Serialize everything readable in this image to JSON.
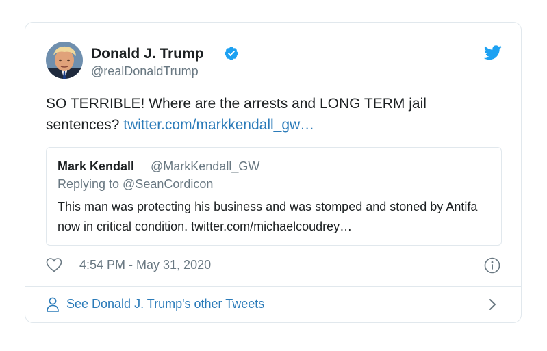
{
  "tweet": {
    "author_name": "Donald J. Trump",
    "author_handle": "@realDonaldTrump",
    "text": "SO TERRIBLE! Where are the arrests and LONG TERM jail sentences? ",
    "link_text": "twitter.com/markkendall_gw…",
    "timestamp": "4:54 PM - May 31, 2020",
    "icons": [
      "verified-badge-icon",
      "twitter-bird-icon",
      "heart-icon",
      "info-icon",
      "person-icon",
      "chevron-right-icon"
    ]
  },
  "quote": {
    "author_name": "Mark Kendall",
    "author_handle": "@MarkKendall_GW",
    "replying_to": "Replying to @SeanCordicon",
    "text": "This man was protecting his business and was stomped and stoned by Antifa now in critical condition. twitter.com/michaelcoudrey…"
  },
  "footer": {
    "see_more_label": "See Donald J. Trump's other Tweets"
  },
  "colors": {
    "link": "#2b7bb9",
    "secondary_text": "#697882",
    "border": "#e1e8ed",
    "verified": "#1da1f2",
    "twitter_blue": "#1da1f2"
  }
}
